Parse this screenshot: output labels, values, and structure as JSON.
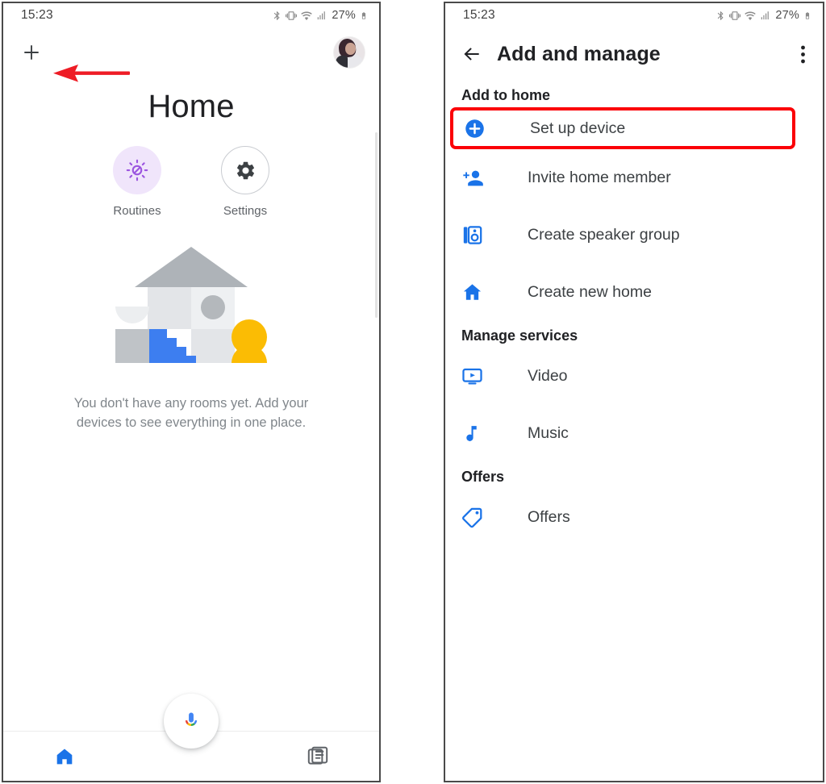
{
  "status_bar": {
    "time": "15:23",
    "battery_percent": "27%",
    "icons": [
      "bluetooth-icon",
      "vibrate-icon",
      "wifi-icon",
      "cellular-signal-icon",
      "battery-icon"
    ]
  },
  "left_screen": {
    "add_button_label": "+",
    "avatar_name": "account-avatar",
    "annotation": {
      "type": "arrow",
      "color": "#ee1c25",
      "points_to": "add-button"
    },
    "page_title": "Home",
    "shortcuts": [
      {
        "label": "Routines",
        "icon": "routines-icon",
        "circle_color": "#f0e5fb",
        "icon_color": "#9c55e0"
      },
      {
        "label": "Settings",
        "icon": "gear-icon",
        "circle_color": "#ffffff",
        "icon_color": "#3c4043"
      }
    ],
    "illustration": {
      "name": "empty-home-illustration",
      "colors": {
        "roof": "#aeb3b8",
        "house_light": "#eceef0",
        "house_mid": "#dfe1e4",
        "house_dark": "#bfc3c7",
        "window": "#b4b8bc",
        "stairs": "#3d7ef0",
        "person": "#fbbc04"
      }
    },
    "empty_state_text": "You don't have any rooms yet. Add your devices to see everything in one place.",
    "bottom_nav": [
      {
        "label": "",
        "icon": "home-icon",
        "active": true,
        "color": "#1a73e8"
      },
      {
        "label": "",
        "icon": "assistant-mic-icon",
        "active": false,
        "color": "#4285f4"
      },
      {
        "label": "",
        "icon": "feed-icon",
        "active": false,
        "color": "#5f6368"
      }
    ]
  },
  "right_screen": {
    "app_bar": {
      "back_icon": "back-arrow-icon",
      "title": "Add and manage",
      "overflow_icon": "more-vert-icon"
    },
    "sections": [
      {
        "heading": "Add to home",
        "items": [
          {
            "label": "Set up device",
            "icon": "add-circle-icon",
            "highlighted": true
          },
          {
            "label": "Invite home member",
            "icon": "person-add-icon",
            "highlighted": false
          },
          {
            "label": "Create speaker group",
            "icon": "speaker-icon",
            "highlighted": false
          },
          {
            "label": "Create new home",
            "icon": "home-filled-icon",
            "highlighted": false
          }
        ]
      },
      {
        "heading": "Manage services",
        "items": [
          {
            "label": "Video",
            "icon": "video-icon",
            "highlighted": false
          },
          {
            "label": "Music",
            "icon": "music-note-icon",
            "highlighted": false
          }
        ]
      },
      {
        "heading": "Offers",
        "items": [
          {
            "label": "Offers",
            "icon": "tag-icon",
            "highlighted": false
          }
        ]
      }
    ],
    "highlight_color": "#fb0007",
    "icon_color": "#1a73e8"
  }
}
